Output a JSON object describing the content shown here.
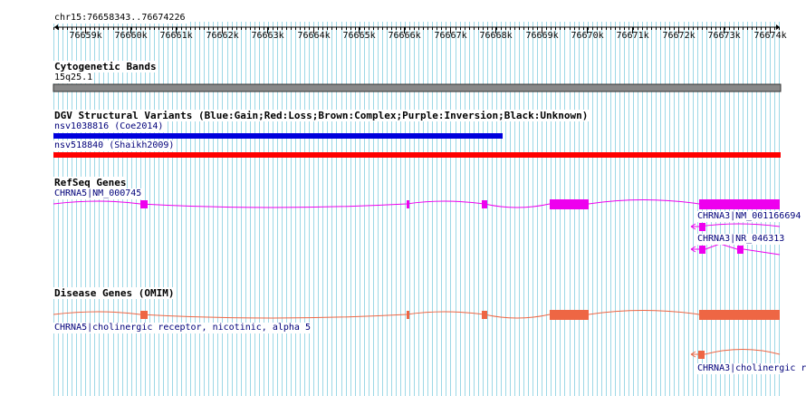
{
  "ruler": {
    "location": "chr15:76658343..76674226",
    "ticks": [
      "76659k",
      "76660k",
      "76661k",
      "76662k",
      "76663k",
      "76664k",
      "76665k",
      "76666k",
      "76667k",
      "76668k",
      "76669k",
      "76670k",
      "76671k",
      "76672k",
      "76673k",
      "76674k"
    ]
  },
  "tracks": {
    "cytoband": {
      "title": "Cytogenetic Bands",
      "band": "15q25.1"
    },
    "dgv": {
      "title": "DGV Structural Variants (Blue:Gain;Red:Loss;Brown:Complex;Purple:Inversion;Black:Unknown)",
      "variants": [
        {
          "label": "nsv1038816 (Coe2014)",
          "color": "#0000dd",
          "type": "Gain"
        },
        {
          "label": "nsv518840 (Shaikh2009)",
          "color": "#ff0000",
          "type": "Loss"
        }
      ]
    },
    "refseq": {
      "title": "RefSeq Genes",
      "color": "#ee00ee",
      "genes": [
        {
          "label": "CHRNA5|NM_000745"
        },
        {
          "label": "CHRNA3|NM_001166694"
        },
        {
          "label": "CHRNA3|NR_046313"
        }
      ]
    },
    "omim": {
      "title": "Disease Genes (OMIM)",
      "color": "#ee6644",
      "genes": [
        {
          "label": "CHRNA5|cholinergic receptor, nicotinic, alpha 5"
        },
        {
          "label": "CHRNA3|cholinergic r"
        }
      ]
    }
  },
  "colors": {
    "grid_line": "#9dd8e6",
    "cytoband_fill": "#888888"
  }
}
